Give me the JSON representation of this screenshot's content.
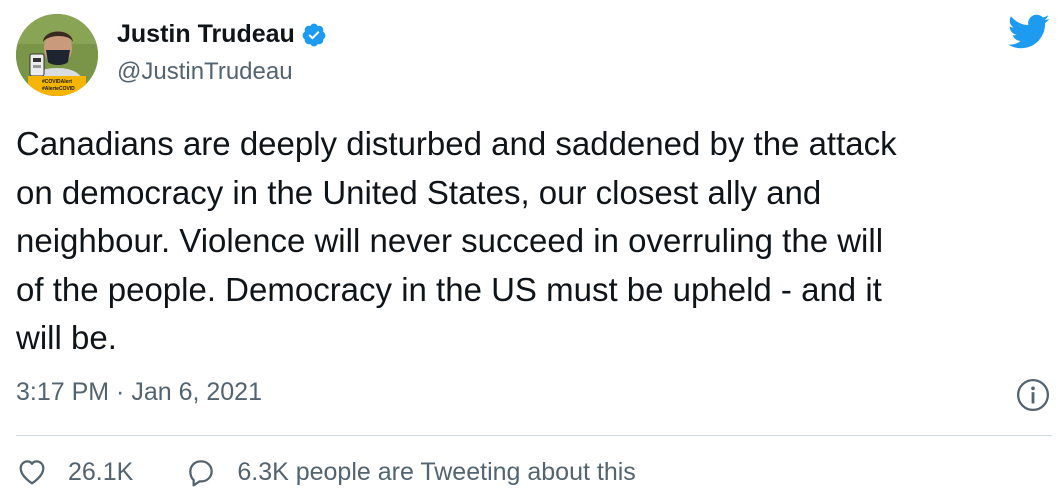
{
  "tweet": {
    "author_name": "Justin Trudeau",
    "author_handle": "@JustinTrudeau",
    "avatar_badge_line1": "#COVIDAlert",
    "avatar_badge_line2": "#AlerteCOVID",
    "text": "Canadians are deeply disturbed and saddened by the attack\non democracy in the United States, our closest ally and\nneighbour. Violence will never succeed in overruling the will\nof the people. Democracy in the US must be upheld - and it\nwill be.",
    "timestamp": "3:17 PM · Jan 6, 2021",
    "likes": "26.1K",
    "discussion": "6.3K people are Tweeting about this"
  },
  "icons": {
    "verified": "verified-badge-icon",
    "logo": "twitter-bird-icon",
    "info": "info-icon",
    "like": "heart-icon",
    "reply": "speech-bubble-icon"
  },
  "colors": {
    "brand_blue": "#1d9bf0",
    "text_primary": "#0f1419",
    "text_secondary": "#536471",
    "divider": "#cfd9de"
  }
}
